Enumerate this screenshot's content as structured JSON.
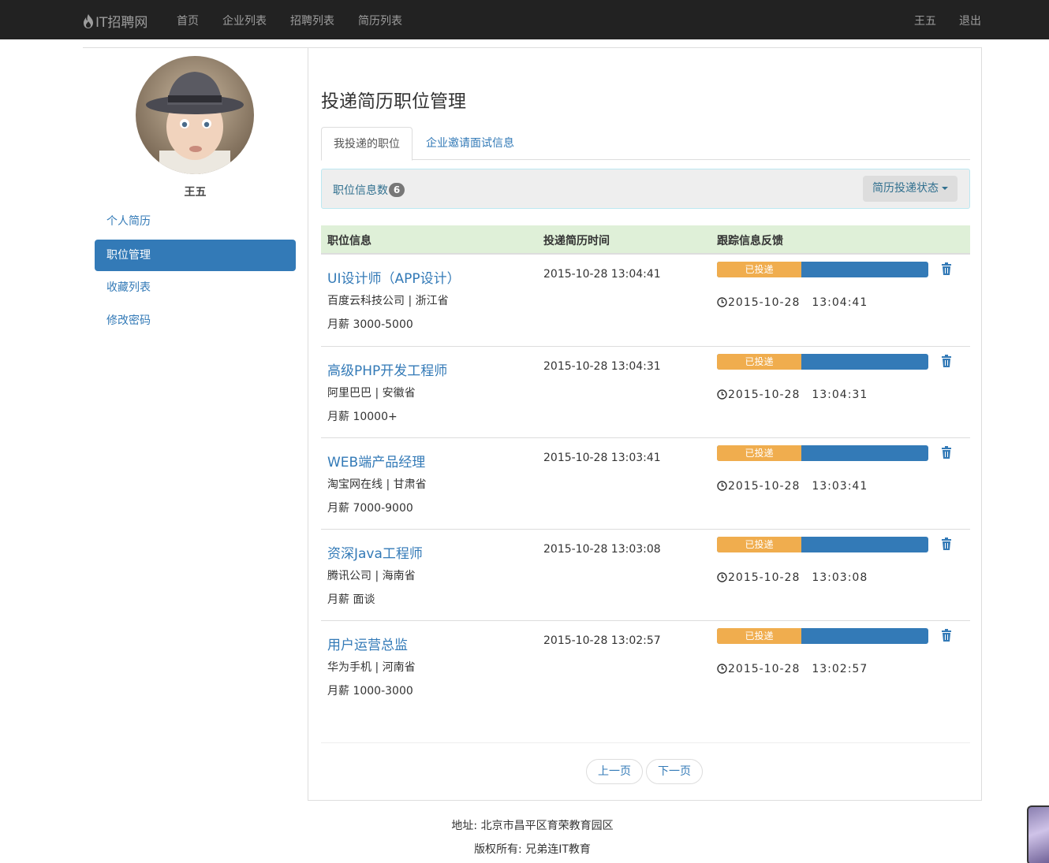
{
  "navbar": {
    "brand": "IT招聘网",
    "links": [
      "首页",
      "企业列表",
      "招聘列表",
      "简历列表"
    ],
    "user": "王五",
    "logout": "退出"
  },
  "sidebar": {
    "username": "王五",
    "items": [
      {
        "label": "个人简历",
        "active": false
      },
      {
        "label": "职位管理",
        "active": true
      },
      {
        "label": "收藏列表",
        "active": false
      },
      {
        "label": "修改密码",
        "active": false
      }
    ]
  },
  "main": {
    "title": "投递简历职位管理",
    "tabs": [
      {
        "label": "我投递的职位",
        "active": true
      },
      {
        "label": "企业邀请面试信息",
        "active": false
      }
    ],
    "info": {
      "label": "职位信息数",
      "count": "6",
      "status_button": "简历投递状态"
    },
    "table": {
      "headers": [
        "职位信息",
        "投递简历时间",
        "跟踪信息反馈"
      ],
      "rows": [
        {
          "title": "UI设计师（APP设计）",
          "company": "百度云科技公司 | 浙江省",
          "salary": "月薪 3000-5000",
          "sent": "2015-10-28 13:04:41",
          "status": "已投递",
          "feedback": "2015-10-28　13:04:41"
        },
        {
          "title": "高级PHP开发工程师",
          "company": "阿里巴巴 | 安徽省",
          "salary": "月薪 10000+",
          "sent": "2015-10-28 13:04:31",
          "status": "已投递",
          "feedback": "2015-10-28　13:04:31"
        },
        {
          "title": "WEB端产品经理",
          "company": "淘宝网在线 | 甘肃省",
          "salary": "月薪 7000-9000",
          "sent": "2015-10-28 13:03:41",
          "status": "已投递",
          "feedback": "2015-10-28　13:03:41"
        },
        {
          "title": "资深Java工程师",
          "company": "腾讯公司 | 海南省",
          "salary": "月薪 面谈",
          "sent": "2015-10-28 13:03:08",
          "status": "已投递",
          "feedback": "2015-10-28　13:03:08"
        },
        {
          "title": "用户运营总监",
          "company": "华为手机 | 河南省",
          "salary": "月薪 1000-3000",
          "sent": "2015-10-28 13:02:57",
          "status": "已投递",
          "feedback": "2015-10-28　13:02:57"
        }
      ]
    },
    "pager": {
      "prev": "上一页",
      "next": "下一页"
    }
  },
  "footer": {
    "address": "地址: 北京市昌平区育荣教育园区",
    "copyright": "版权所有: 兄弟连IT教育"
  },
  "colors": {
    "navbar_bg": "#222222",
    "primary": "#337ab7",
    "warning": "#f0ad4e",
    "header_row": "#dff0d8"
  }
}
